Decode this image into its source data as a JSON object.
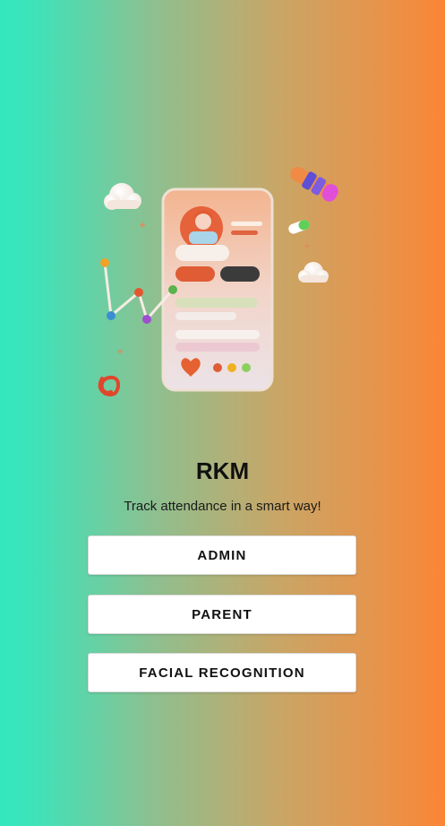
{
  "app": {
    "title": "RKM",
    "tagline": "Track attendance in a smart way!"
  },
  "buttons": {
    "admin": "ADMIN",
    "parent": "PARENT",
    "facial_recognition": "FACIAL RECOGNITION"
  },
  "colors": {
    "gradient_left": "#34e8be",
    "gradient_right": "#fb8536",
    "button_bg": "#ffffff",
    "text": "#111111"
  },
  "illustration": {
    "icon": "phone-profile-illustration"
  }
}
